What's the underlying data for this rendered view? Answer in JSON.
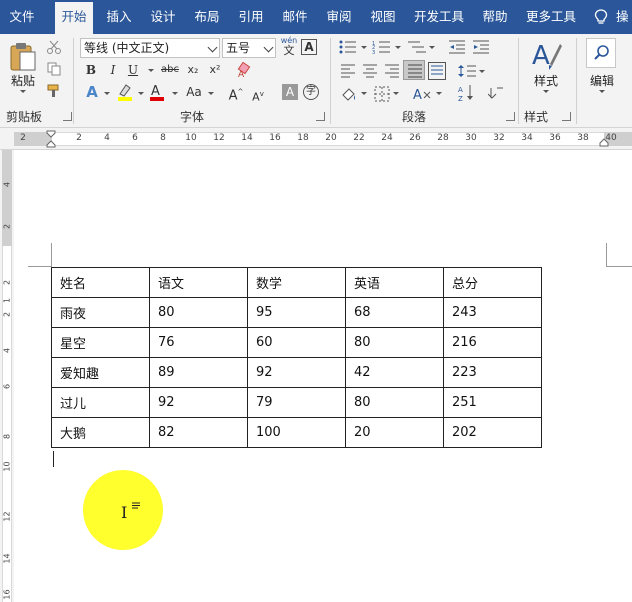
{
  "menu": {
    "tabs": [
      {
        "label": "文件"
      },
      {
        "label": "开始"
      },
      {
        "label": "插入"
      },
      {
        "label": "设计"
      },
      {
        "label": "布局"
      },
      {
        "label": "引用"
      },
      {
        "label": "邮件"
      },
      {
        "label": "审阅"
      },
      {
        "label": "视图"
      },
      {
        "label": "开发工具"
      },
      {
        "label": "帮助"
      },
      {
        "label": "更多工具"
      }
    ],
    "active_tab": "开始",
    "tell_me_partial": "操"
  },
  "ribbon": {
    "clipboard": {
      "paste_label": "粘贴",
      "group_label": "剪贴板"
    },
    "font": {
      "font_name": "等线 (中文正文)",
      "font_size": "五号",
      "phonetic_label": "wén",
      "phonetic_sub": "文",
      "char_border": "A",
      "group_label": "字体",
      "bold": "B",
      "italic": "I",
      "underline": "U",
      "strike": "abc",
      "subscript": "x₂",
      "superscript": "x²",
      "change_case": "Aa",
      "highlight_color": "#ffff00",
      "font_color": "#e00000"
    },
    "paragraph": {
      "group_label": "段落"
    },
    "styles": {
      "label": "样式",
      "group_label": "样式"
    },
    "editing": {
      "label": "编辑"
    }
  },
  "ruler": {
    "horizontal_numbers": [
      "2",
      "2",
      "4",
      "6",
      "8",
      "10",
      "12",
      "14",
      "16",
      "18",
      "20",
      "22",
      "24",
      "26",
      "28",
      "30",
      "32",
      "34",
      "36",
      "38",
      "40"
    ],
    "vertical_numbers": [
      "4",
      "2",
      "2",
      "1",
      "2",
      "4",
      "6",
      "8",
      "10",
      "12",
      "14",
      "16"
    ]
  },
  "table": {
    "header": [
      "姓名",
      "语文",
      "数学",
      "英语",
      "总分"
    ],
    "rows": [
      [
        "雨夜",
        "80",
        "95",
        "68",
        "243"
      ],
      [
        "星空",
        "76",
        "60",
        "80",
        "216"
      ],
      [
        "爱知趣",
        "89",
        "92",
        "42",
        "223"
      ],
      [
        "过儿",
        "92",
        "79",
        "80",
        "251"
      ],
      [
        "大鹅",
        "82",
        "100",
        "20",
        "202"
      ]
    ]
  },
  "colors": {
    "ribbon_blue": "#2b579a",
    "ribbon_bg": "#f3f3f3",
    "highlight_circle": "#ffff00"
  }
}
